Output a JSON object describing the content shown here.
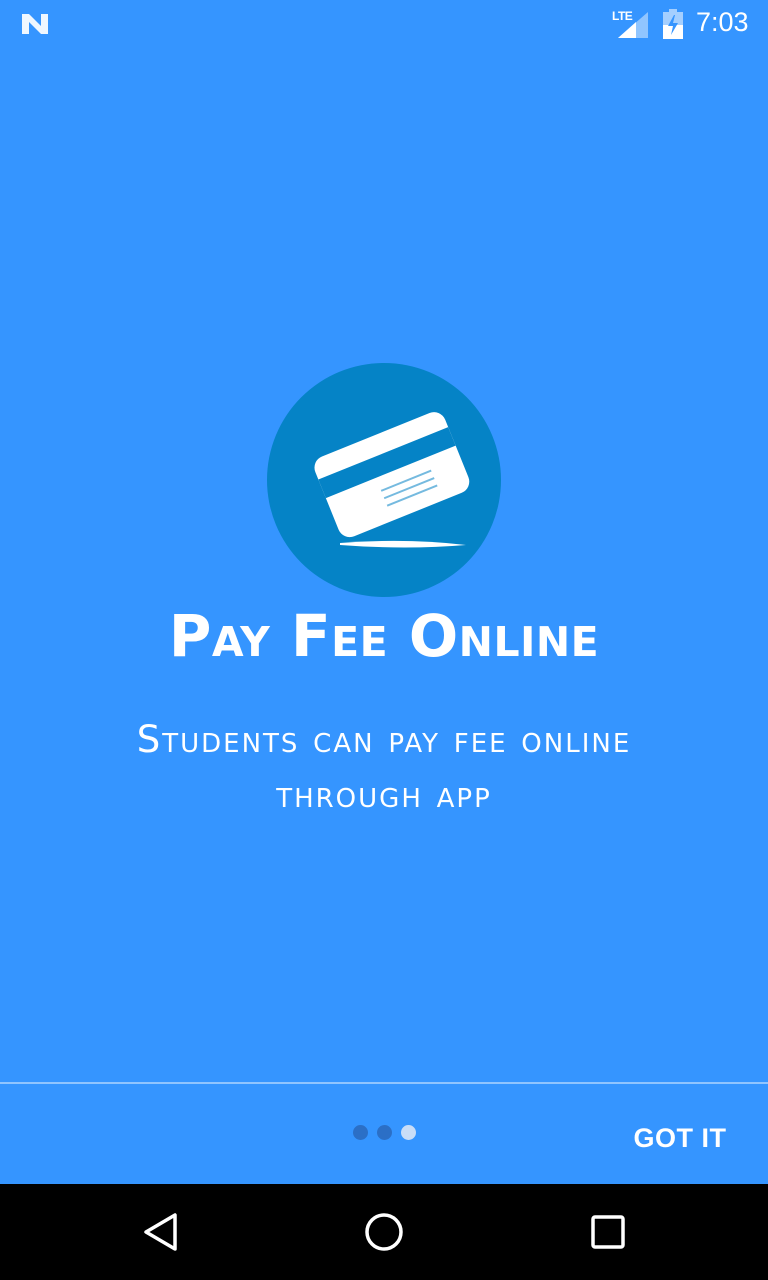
{
  "status_bar": {
    "notification_icon": "n-notification-icon",
    "network_label": "LTE",
    "signal_icon": "cell-signal-icon",
    "battery_icon": "battery-charging-icon",
    "time": "7:03"
  },
  "slide": {
    "illustration_icon": "credit-card-icon",
    "title": "Pay Fee Online",
    "description": "Students can pay fee online through app",
    "colors": {
      "background": "#3595ff",
      "illustration_circle": "#0583c6",
      "card_fill": "#ffffff",
      "card_stripe": "#0583c6"
    }
  },
  "footer": {
    "page_count": 3,
    "current_page": 3,
    "dot_inactive_color": "#2b6fc6",
    "dot_active_color": "#c9ddf7",
    "got_it_label": "GOT IT"
  },
  "nav_bar": {
    "back_icon": "back-triangle-icon",
    "home_icon": "home-circle-icon",
    "recents_icon": "recents-square-icon"
  }
}
